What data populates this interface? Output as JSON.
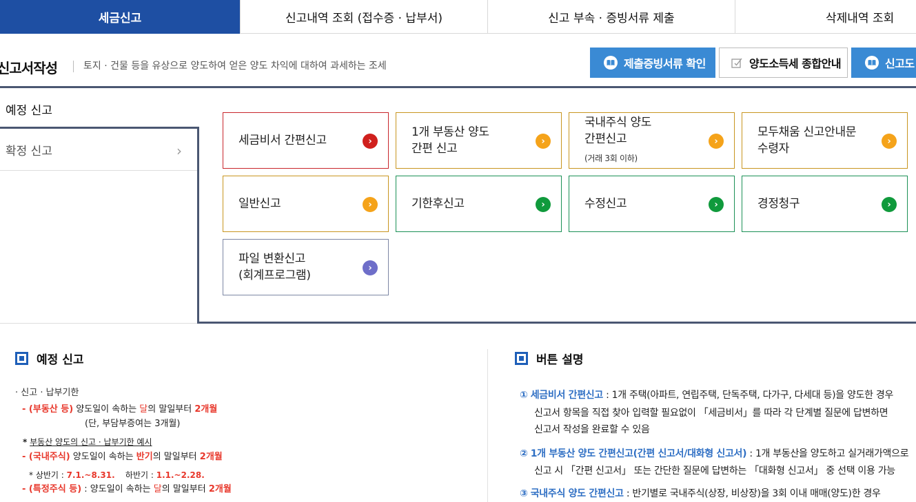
{
  "tabs": [
    "세금신고",
    "신고내역 조회 (접수증 · 납부서)",
    "신고 부속 · 증빙서류 제출",
    "삭제내역 조회"
  ],
  "page_title": "신고서작성",
  "page_desc": "토지 · 건물 등을 유상으로 양도하여 얻은 양도 차익에 대하여 과세하는 조세",
  "top_buttons": {
    "proof": "제출증빙서류 확인",
    "guide": "양도소득세 종합안내",
    "manual": "신고도"
  },
  "side_menu": {
    "yejeong": "예정 신고",
    "hwakjeong": "확정 신고",
    "chevron": "›"
  },
  "cards": [
    {
      "l1": "세금비서 간편신고",
      "l2": ""
    },
    {
      "l1": "1개 부동산 양도",
      "l2": "간편 신고"
    },
    {
      "l1": "국내주식 양도",
      "l2": "간편신고",
      "sub": "(거래 3회 이하)"
    },
    {
      "l1": "모두채움 신고안내문",
      "l2": "수령자"
    },
    {
      "l1": "일반신고",
      "l2": ""
    },
    {
      "l1": "기한후신고",
      "l2": ""
    },
    {
      "l1": "수정신고",
      "l2": ""
    },
    {
      "l1": "경정청구",
      "l2": ""
    },
    {
      "l1": "파일 변환신고",
      "l2": "(회계프로그램)"
    }
  ],
  "arrow": "›",
  "left_section": {
    "heading": "예정 신고",
    "bullet": "· 신고 · 납부기한",
    "re_label": "- (부동산  등)",
    "re_t1": "  양도일이 속하는 ",
    "re_t2": "달",
    "re_t3": "의 말일부터 ",
    "re_t4": "2개월",
    "re_note": "(단, 부담부증여는 3개월)",
    "example": "부동산 양도의 신고 · 납부기한 예시",
    "star": "*",
    "st_label": "- (국내주식)",
    "st_t1": "  양도일이 속하는 ",
    "st_t2": "반기",
    "st_t3": "의 말일부터 ",
    "st_t4": "2개월",
    "half_t1": "* 상반기 : ",
    "half_t2": "7.1.~8.31.",
    "half_t3": "    하반기 : ",
    "half_t4": "1.1.~2.28.",
    "sp_label": "- (특정주식 등)",
    "sp_t1": " : 양도일이 속하는 ",
    "sp_t2": "달",
    "sp_t3": "의 말일부터 ",
    "sp_t4": "2개월"
  },
  "right_section": {
    "heading": "버튼 설명",
    "i1_num": "①",
    "i1_name": "세금비서 간편신고",
    "i1_t": " : 1개 주택(아파트, 연립주택, 단독주택, 다가구, 다세대 등)을 양도한 경우",
    "i1_l2": "신고서 항목을 직접 찾아 입력할 필요없이 「세금비서」를 따라 각 단계별 질문에 답변하면",
    "i1_l3": "신고서 작성을 완료할 수 있음",
    "i2_num": "②",
    "i2_name": "1개 부동산 양도 간편신고(간편 신고서/대화형 신고서)",
    "i2_t": " : 1개 부동산을 양도하고 실거래가액으로",
    "i2_l2": "신고 시 「간편 신고서」 또는 간단한 질문에 답변하는 「대화형 신고서」 중 선택 이용 가능",
    "i3_num": "③",
    "i3_name": "국내주식 양도 간편신고",
    "i3_t": " : 반기별로 국내주식(상장, 비상장)을 3회 이내 매매(양도)한 경우"
  }
}
